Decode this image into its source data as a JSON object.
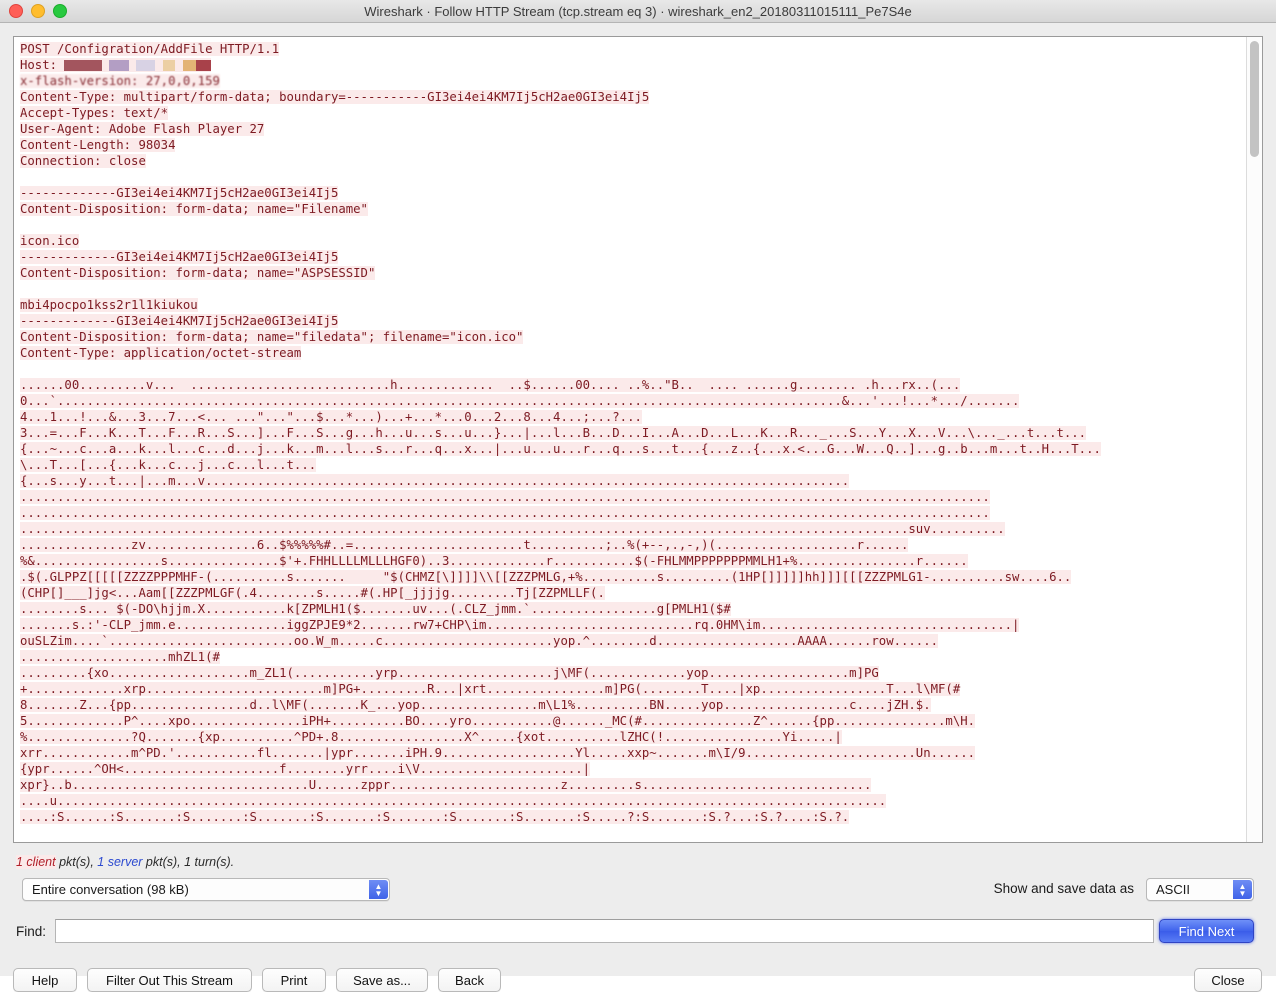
{
  "window": {
    "title": "Wireshark · Follow HTTP Stream (tcp.stream eq 3) · wireshark_en2_20180311015111_Pe7S4e",
    "traffic_lights": {
      "close": "close-button",
      "minimize": "minimize-button",
      "zoom": "zoom-button"
    }
  },
  "stream": {
    "headers": [
      "POST /Configration/AddFile HTTP/1.1",
      "Host: ",
      "x-flash-version: 27,0,0,159",
      "Content-Type: multipart/form-data; boundary=-----------GI3ei4ei4KM7Ij5cH2ae0GI3ei4Ij5",
      "Accept-Types: text/*",
      "User-Agent: Adobe Flash Player 27",
      "Content-Length: 98034",
      "Connection: close"
    ],
    "multipart": [
      "-------------GI3ei4ei4KM7Ij5cH2ae0GI3ei4Ij5",
      "Content-Disposition: form-data; name=\"Filename\"",
      "",
      "icon.ico",
      "-------------GI3ei4ei4KM7Ij5cH2ae0GI3ei4Ij5",
      "Content-Disposition: form-data; name=\"ASPSESSID\"",
      "",
      "mbi4pocpo1kss2r1l1kiukou",
      "-------------GI3ei4ei4KM7Ij5cH2ae0GI3ei4Ij5",
      "Content-Disposition: form-data; name=\"filedata\"; filename=\"icon.ico\"",
      "Content-Type: application/octet-stream"
    ],
    "payload": [
      "......00.........v...  ...........................h.............  ..$......00.... ..%..\"B..  .... ......g........ .h...rx..(...",
      "0...`..........................................................................................................&...'...!...*.../.......",
      "4...1...!...&...3...7...<... ...\"...\"...$...*...)...+...*...0...2...8...4...;...?...",
      "3...=...F...K...T...F...R...S...]...F...S...g...h...u...s...u...}...|...l...B...D...I...A...D...L...K...R..._...S...Y...X...V...\\..._...t...t...",
      "{...~...c...a...k...l...c...d...j...k...m...l...s...r...q...x...|...u...u...r...q...s...t...{...z..{...x.<...G...W...Q..]...g..b...m...t..H...T...",
      "\\...T...[...{...k...c...j...c...l...t...",
      "{...s...y...t...|...m...v.......................................................................................",
      "...................................................................................................................................",
      "...................................................................................................................................",
      "........................................................................................................................suv..........",
      "...............zv...............6..$%%%%%#..=.......................t..........;..%(+--,.,-,)(...................r......",
      "%&.................s...............$'+.FHHLLLLMLLLHGF0)..3.............r...........$(-FHLMMPPPPPPPMMLH1+%................r......",
      ".$(.GLPPZ[[[[[ZZZZPPPMHF-(..........s.......     \"$(CHMZ[\\]]]]\\\\[[ZZZPMLG,+%..........s.........(1HP[]]]]]hh]]][[[ZZZPMLG1-..........sw....6..",
      "(CHP[]___]jg<...Aam[[ZZZPMLGF(.4........s.....#(.HP[_jjjjg.........Tj[ZZPMLLF(.",
      "........s... $(-DO\\hjjm.X...........k[ZPMLH1($.......uv...(.CLZ_jmm.`.................g[PMLH1($#",
      ".......s.:'-CLP_jmm.e...............iggZPJE9*2.......rw7+CHP\\im............................rq.0HM\\im..................................|",
      "ouSLZim....`.........................oo.W_m.....c.......................yop.^........d...................AAAA......row......",
      "....................mhZL1(#",
      ".........{xo...................m_ZL1(...........yrp.....................j\\MF(.............yop...................m]PG",
      "+.............xrp........................m]PG+.........R...|xrt................m]PG(........T....|xp.................T...l\\MF(#",
      "8.......Z...{pp................d..l\\MF(.......K_...yop................m\\L1%..........BN.....yop.................c....jZH.$.",
      "5.............P^....xpo...............iPH+..........BO....yro...........@......_MC(#...............Z^......{pp...............m\\H.",
      "%..............?Q.......{xp..........^PD+.8.................X^.....{xot..........lZHC(!................Yi.....|",
      "xrr............m^PD.'...........fl.......|ypr.......iPH.9..................Yl.....xxp~.......m\\I/9.......................Un......",
      "{ypr......^OH<.....................f........yrr....i\\V......................|",
      "xpr}..b................................U......zppr.......................z.........s...............................",
      "....u................................................................................................................",
      "....:S......:S.......:S.......:S.......:S.......:S.......:S.......:S.......:S.....?:S.......:S.?...:S.?....:S.?."
    ]
  },
  "status": {
    "client_count": "1 client",
    "client_suffix": " pkt(s), ",
    "server_count": "1 server",
    "server_suffix": " pkt(s), 1 turn(s)."
  },
  "controls": {
    "conversation_value": "Entire conversation (98 kB)",
    "show_save_label": "Show and save data as",
    "format_value": "ASCII",
    "find_label": "Find:",
    "find_value": "",
    "find_placeholder": "",
    "find_next_label": "Find Next"
  },
  "buttons": {
    "help": "Help",
    "filter_out": "Filter Out This Stream",
    "print": "Print",
    "save_as": "Save as...",
    "back": "Back",
    "close": "Close"
  },
  "colors": {
    "client_text": "#b0202a",
    "server_text": "#2c4ad0",
    "payload_text": "#7d1a22",
    "payload_highlight": "#fbeaea",
    "accent_blue": "#4063ec"
  }
}
